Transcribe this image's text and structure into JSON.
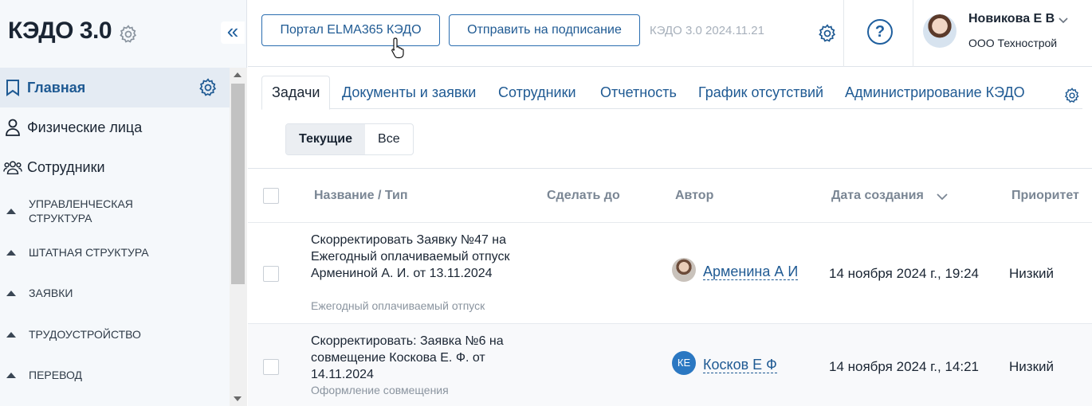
{
  "app": {
    "title": "КЭДО 3.0",
    "collapse_glyph": "«"
  },
  "sidebar": {
    "items": [
      {
        "label": "Главная",
        "icon": "bookmark-icon",
        "active": true
      },
      {
        "label": "Физические лица",
        "icon": "person-icon"
      },
      {
        "label": "Сотрудники",
        "icon": "people-icon"
      }
    ],
    "subitems": [
      "Управленческая структура",
      "Штатная структура",
      "Заявки",
      "Трудоустройство",
      "Перевод"
    ]
  },
  "header": {
    "portal_button": "Портал ELMA365 КЭДО",
    "send_button": "Отправить на подписание",
    "version": "КЭДО 3.0 2024.11.21",
    "help_glyph": "?",
    "user_name": "Новикова Е В",
    "user_org": "ООО Технострой"
  },
  "tabs": [
    "Задачи",
    "Документы и заявки",
    "Сотрудники",
    "Отчетность",
    "График отсутствий",
    "Администрирование КЭДО"
  ],
  "filter": {
    "current": "Текущие",
    "all": "Все"
  },
  "table": {
    "columns": {
      "name": "Название / Тип",
      "due": "Сделать до",
      "author": "Автор",
      "created": "Дата создания",
      "priority": "Приоритет"
    },
    "rows": [
      {
        "title": "Скорректировать Заявку №47 на Ежегодный оплачиваемый отпуск Армениной А. И. от 13.11.2024",
        "type": "Ежегодный оплачиваемый отпуск",
        "author": "Арменина А И",
        "author_initials": "",
        "created": "14 ноября 2024 г., 19:24",
        "priority": "Низкий"
      },
      {
        "title": "Скорректировать: Заявка №6 на совмещение Коскова Е. Ф. от 14.11.2024",
        "type": "Оформление совмещения",
        "author": "Косков Е Ф",
        "author_initials": "КЕ",
        "created": "14 ноября 2024 г., 14:21",
        "priority": "Низкий"
      }
    ]
  },
  "colors": {
    "accent": "#1f5a93",
    "sidebar_bg": "#f5f8fb",
    "avatar_ke": "#2b78c2"
  }
}
